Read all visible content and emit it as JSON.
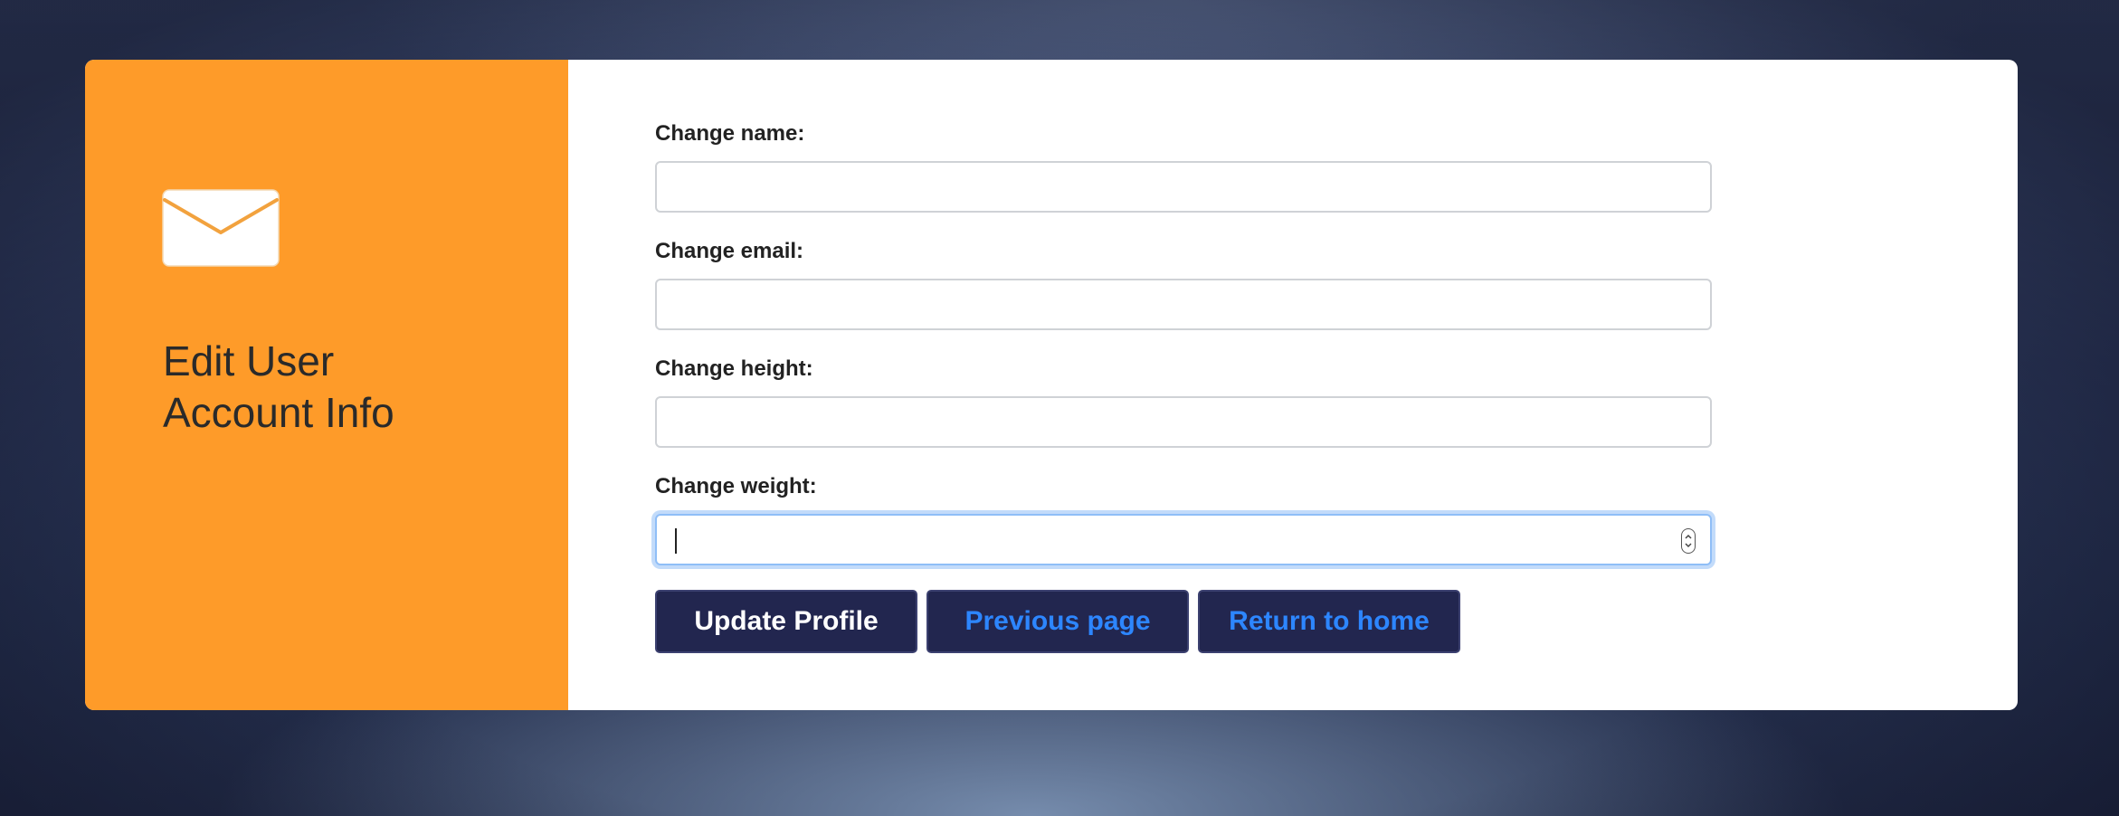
{
  "sidebar": {
    "icon": "envelope-icon",
    "title_line1": "Edit User",
    "title_line2": "Account Info",
    "background_color": "#fe9b29"
  },
  "form": {
    "name_label": "Change name:",
    "name_value": "",
    "email_label": "Change email:",
    "email_value": "",
    "height_label": "Change height:",
    "height_value": "",
    "weight_label": "Change weight:",
    "weight_value": ""
  },
  "buttons": {
    "update_label": "Update Profile",
    "previous_label": "Previous page",
    "home_label": "Return to home",
    "button_color": "#22264f",
    "link_text_color": "#2d86ff"
  }
}
